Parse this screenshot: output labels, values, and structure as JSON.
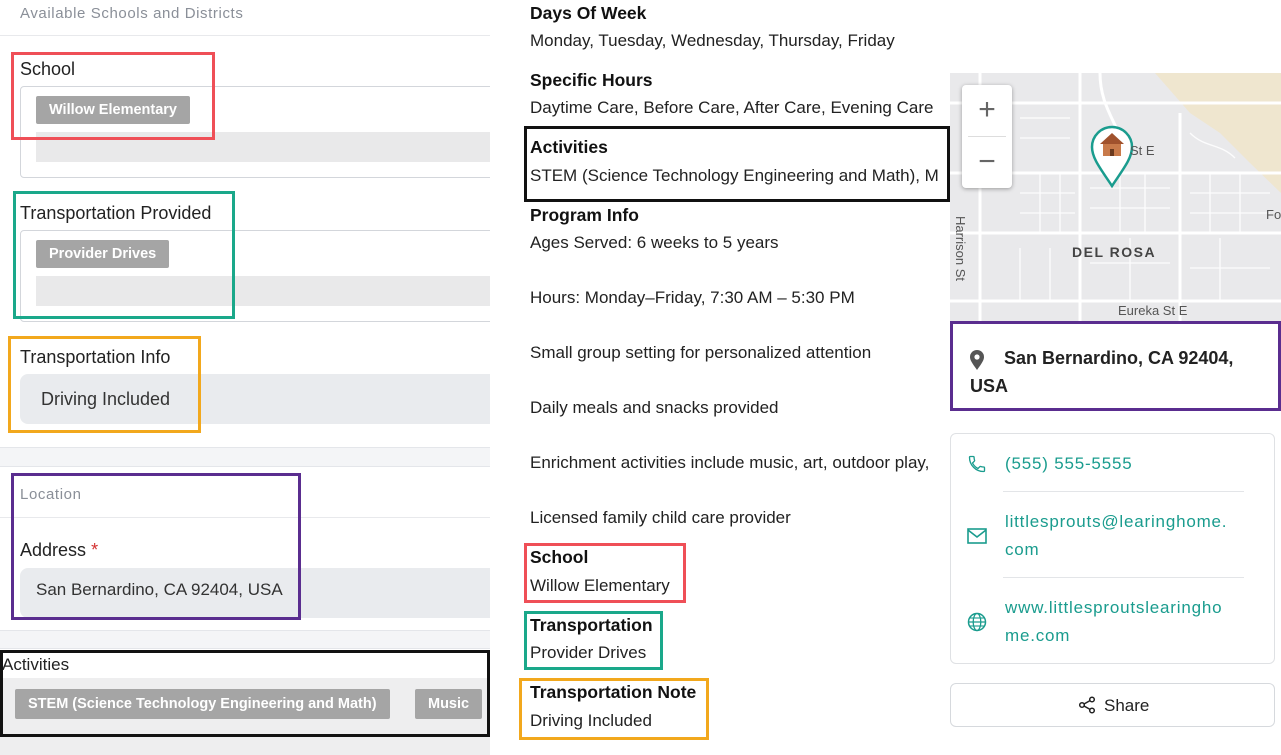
{
  "form": {
    "section_schools": "Available Schools and Districts",
    "school_label": "School",
    "school_chip": "Willow Elementary",
    "transport_provided_label": "Transportation Provided",
    "transport_provided_chip": "Provider Drives",
    "transport_info_label": "Transportation Info",
    "transport_info_value": "Driving Included",
    "section_location": "Location",
    "address_label": "Address",
    "address_required": "*",
    "address_value": "San Bernardino, CA 92404, USA",
    "activities_label": "Activities",
    "activities_chips": [
      "STEM (Science Technology Engineering and Math)",
      "Music"
    ]
  },
  "details": {
    "days_label": "Days Of Week",
    "days_value": "Monday, Tuesday, Wednesday, Thursday, Friday",
    "hours_label": "Specific Hours",
    "hours_value": "Daytime Care, Before Care, After Care, Evening Care",
    "activities_label": "Activities",
    "activities_value": "STEM (Science Technology Engineering and Math), M",
    "program_label": "Program Info",
    "program_lines": [
      "Ages Served: 6 weeks to 5 years",
      "Hours: Monday–Friday, 7:30 AM – 5:30 PM",
      "Small group setting for personalized attention",
      "Daily meals and snacks provided",
      "Enrichment activities include music, art, outdoor play,",
      "Licensed family child care provider"
    ],
    "school_label": "School",
    "school_value": "Willow Elementary",
    "transport_label": "Transportation",
    "transport_value": "Provider Drives",
    "transport_note_label": "Transportation Note",
    "transport_note_value": "Driving Included"
  },
  "map": {
    "zoom_in": "+",
    "zoom_out": "−",
    "labels": {
      "street_st_e": "St E",
      "fo": "Fo",
      "harrison": "Harrison St",
      "del_rosa": "DEL ROSA",
      "eureka": "Eureka St E"
    },
    "marker_icon": "school-house-icon"
  },
  "sidebar": {
    "address_line1": "San Bernardino, CA 92404,",
    "address_line2": "USA",
    "phone": "(555) 555-5555",
    "email_line1": "littlesprouts@learinghome.",
    "email_line2": "com",
    "website_line1": "www.littlesproutslearingho",
    "website_line2": "me.com",
    "share_label": "Share"
  },
  "colors": {
    "accent": "#1a9c8e",
    "chip": "#a5a5a5",
    "anno_red": "#ef4f57",
    "anno_green": "#1aa88a",
    "anno_orange": "#f2a81d",
    "anno_purple": "#5a2d8f",
    "anno_black": "#111111"
  }
}
